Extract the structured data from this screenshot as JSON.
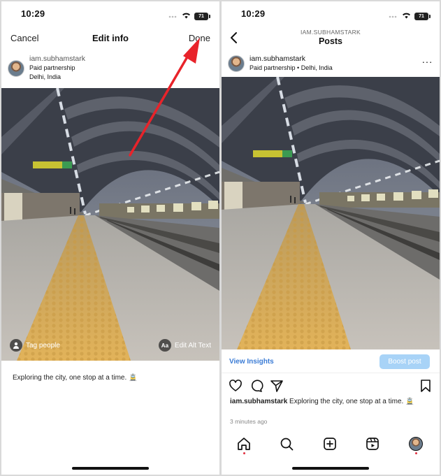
{
  "left": {
    "status": {
      "time": "10:29",
      "battery": "71"
    },
    "nav": {
      "cancel_label": "Cancel",
      "title": "Edit info",
      "done_label": "Done"
    },
    "post": {
      "username": "iam.subhamstark",
      "partnership": "Paid partnership",
      "location": "Delhi, India"
    },
    "photo_actions": {
      "tag_people": "Tag people",
      "alt_text_icon": "Aa",
      "edit_alt_text": "Edit Alt Text"
    },
    "caption": "Exploring the city, one stop at a time. 🚊"
  },
  "right": {
    "status": {
      "time": "10:29",
      "battery": "71"
    },
    "nav": {
      "profile": "IAM.SUBHAMSTARK",
      "title": "Posts"
    },
    "post": {
      "username": "iam.subhamstark",
      "meta": "Paid partnership  •  Delhi, India"
    },
    "insights_label": "View Insights",
    "boost_label": "Boost post",
    "caption_username": "iam.subhamstark",
    "caption_text": "Exploring the city, one stop at a time. 🚊",
    "time_ago": "3 minutes ago"
  },
  "icons": [
    "signal-icon",
    "wifi-icon",
    "battery-icon",
    "back-chevron-icon",
    "more-icon",
    "person-icon",
    "heart-icon",
    "comment-icon",
    "share-icon",
    "bookmark-icon",
    "home-icon",
    "search-icon",
    "create-icon",
    "reels-icon",
    "profile-avatar-icon"
  ],
  "colors": {
    "annotation_arrow": "#e8232a",
    "link_blue": "#3a7bd5",
    "boost_button": "#a8d3f7",
    "tactile_path": "#d9a94a"
  }
}
